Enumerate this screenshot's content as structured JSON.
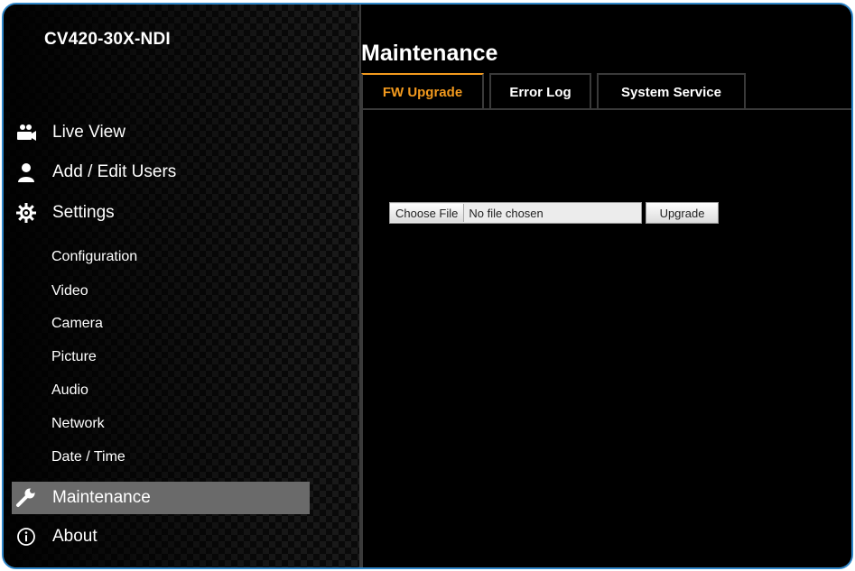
{
  "device": {
    "name": "CV420-30X-NDI"
  },
  "nav": {
    "live_view": "Live View",
    "users": "Add / Edit Users",
    "settings": "Settings",
    "sub": {
      "configuration": "Configuration",
      "video": "Video",
      "camera": "Camera",
      "picture": "Picture",
      "audio": "Audio",
      "network": "Network",
      "datetime": "Date / Time"
    },
    "maintenance": "Maintenance",
    "about": "About"
  },
  "page": {
    "title": "Maintenance"
  },
  "tabs": {
    "fw_upgrade": "FW Upgrade",
    "error_log": "Error Log",
    "system_service": "System Service"
  },
  "upgrade": {
    "choose_label": "Choose File",
    "file_status": "No file chosen",
    "upgrade_label": "Upgrade"
  },
  "colors": {
    "accent": "#f39a1e",
    "frame": "#2f86c8",
    "active_bg": "#6a6a6a"
  }
}
